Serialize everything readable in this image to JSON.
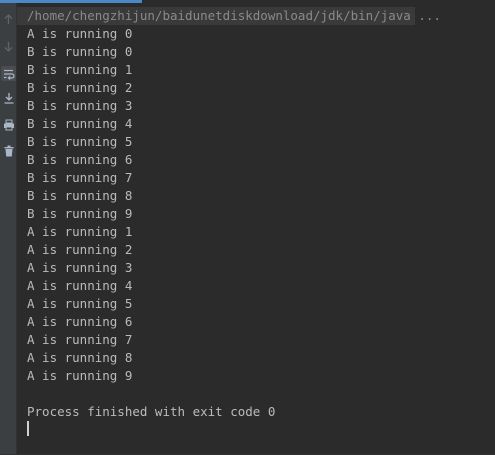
{
  "console": {
    "command": "/home/chengzhijun/baidunetdiskdownload/jdk/bin/java ...",
    "lines": [
      "A is running 0",
      "B is running 0",
      "B is running 1",
      "B is running 2",
      "B is running 3",
      "B is running 4",
      "B is running 5",
      "B is running 6",
      "B is running 7",
      "B is running 8",
      "B is running 9",
      "A is running 1",
      "A is running 2",
      "A is running 3",
      "A is running 4",
      "A is running 5",
      "A is running 6",
      "A is running 7",
      "A is running 8",
      "A is running 9"
    ],
    "exit_message": "Process finished with exit code 0"
  },
  "toolbar": {
    "icons": [
      "arrow-up-icon",
      "arrow-down-icon",
      "soft-wrap-icon",
      "scroll-to-end-icon",
      "print-icon",
      "trash-icon"
    ]
  },
  "colors": {
    "background": "#2b2b2b",
    "toolbar": "#3c3f41",
    "text": "#bbbbbb",
    "accent": "#4a88c7"
  }
}
